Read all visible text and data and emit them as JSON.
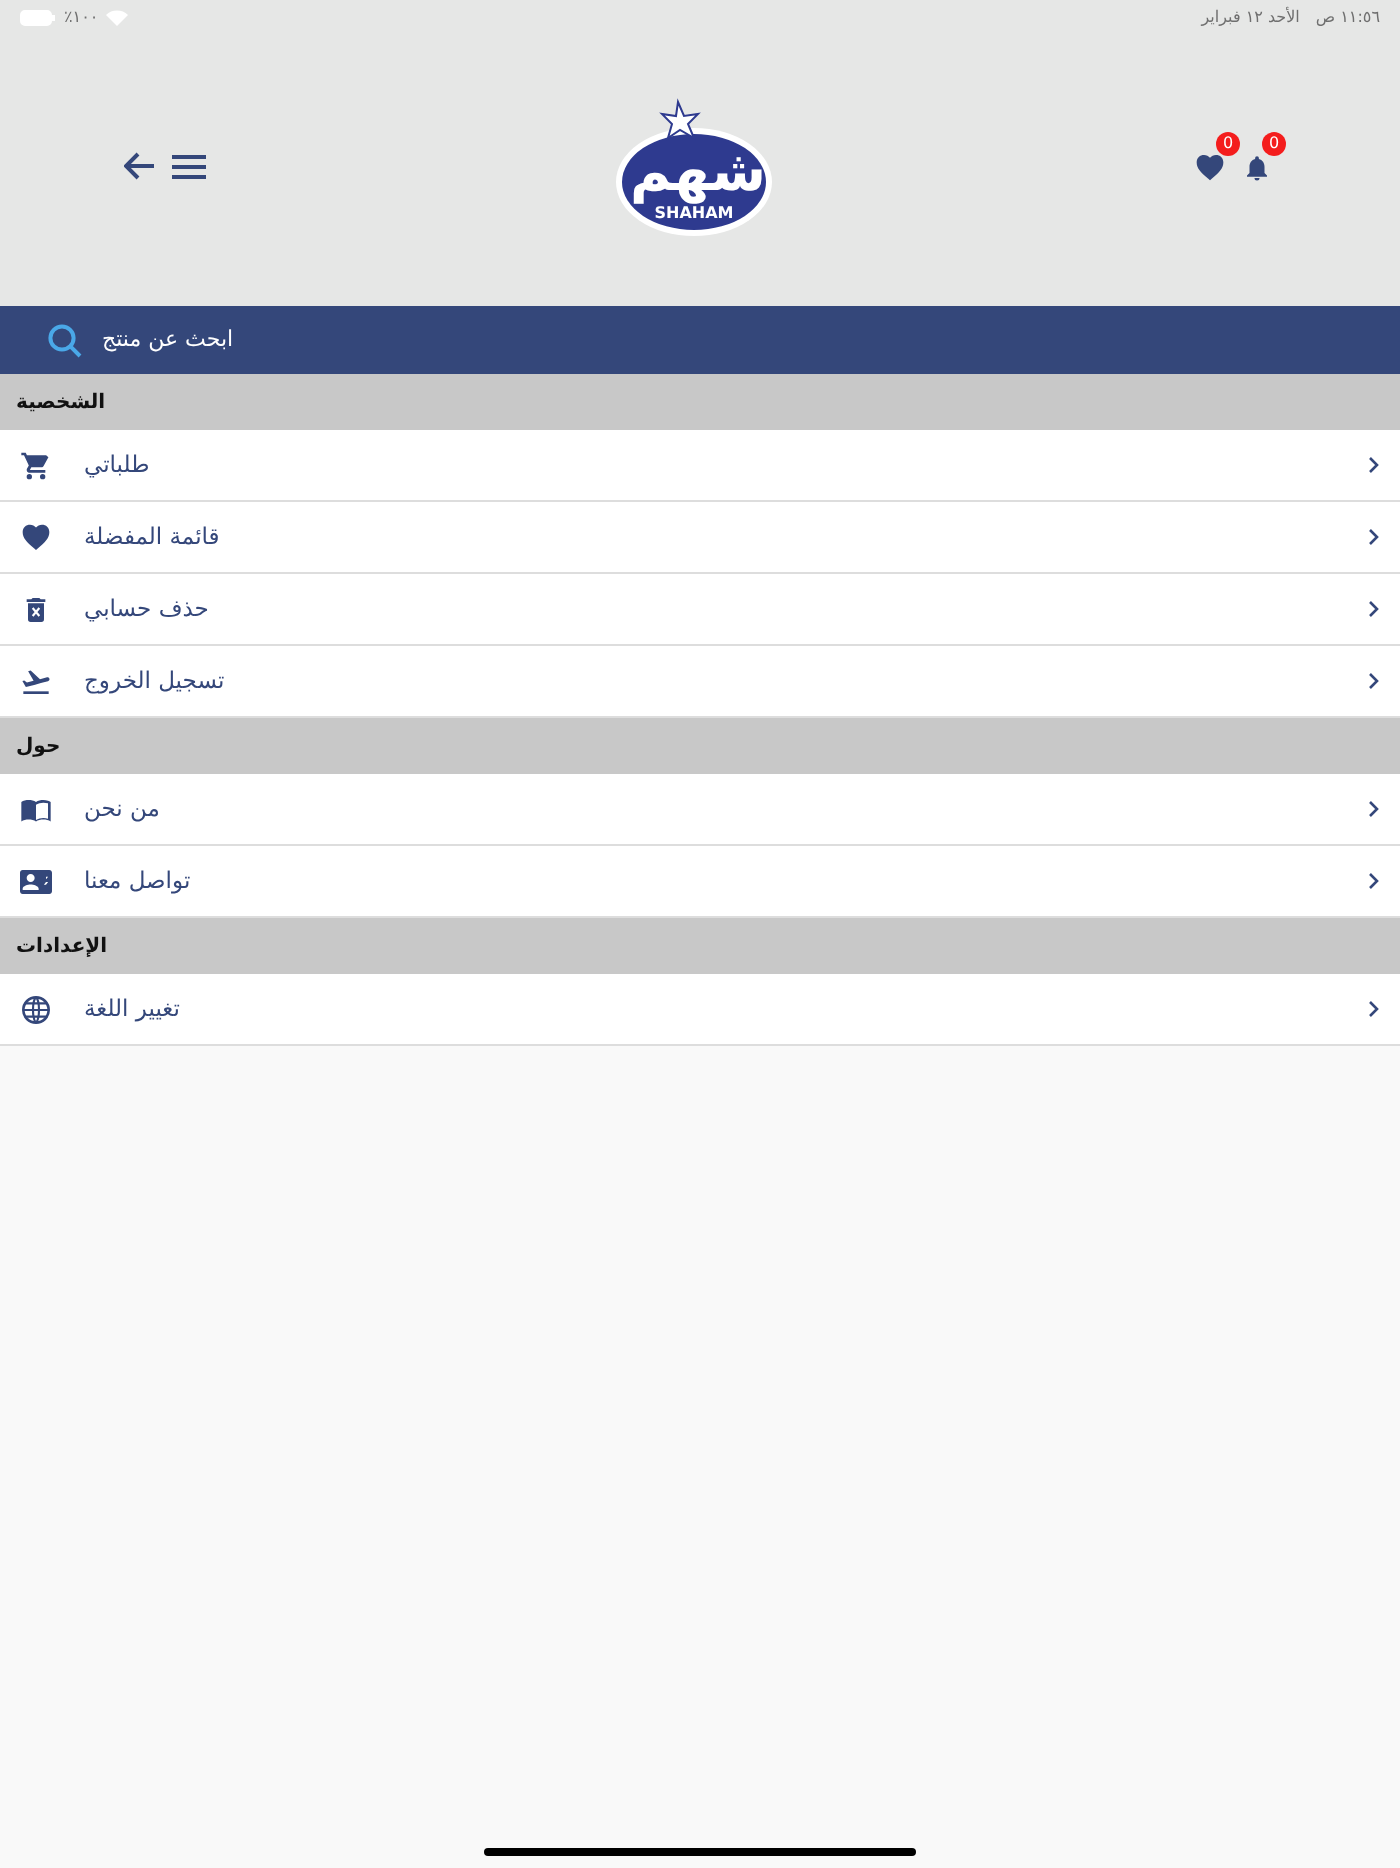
{
  "status_bar": {
    "time": "١١:٥٦ ص",
    "date": "الأحد ١٢ فبراير",
    "battery": "٪١٠٠"
  },
  "header": {
    "logo": {
      "text": "شهم",
      "subtext": "SHAHAM"
    },
    "favorites_count": "0",
    "notifications_count": "0"
  },
  "search": {
    "placeholder": "ابحث عن منتج"
  },
  "sections": [
    {
      "title": "الشخصية",
      "items": [
        {
          "label": "طلباتي",
          "kind": "cart"
        },
        {
          "label": "قائمة المفضلة",
          "kind": "heart"
        },
        {
          "label": "حذف حسابي",
          "kind": "trash"
        },
        {
          "label": "تسجيل الخروج",
          "kind": "plane"
        }
      ]
    },
    {
      "title": "حول",
      "items": [
        {
          "label": "من نحن",
          "kind": "book"
        },
        {
          "label": "تواصل معنا",
          "kind": "contact"
        }
      ]
    },
    {
      "title": "الإعدادات",
      "items": [
        {
          "label": "تغيير اللغة",
          "kind": "globe"
        }
      ]
    }
  ]
}
